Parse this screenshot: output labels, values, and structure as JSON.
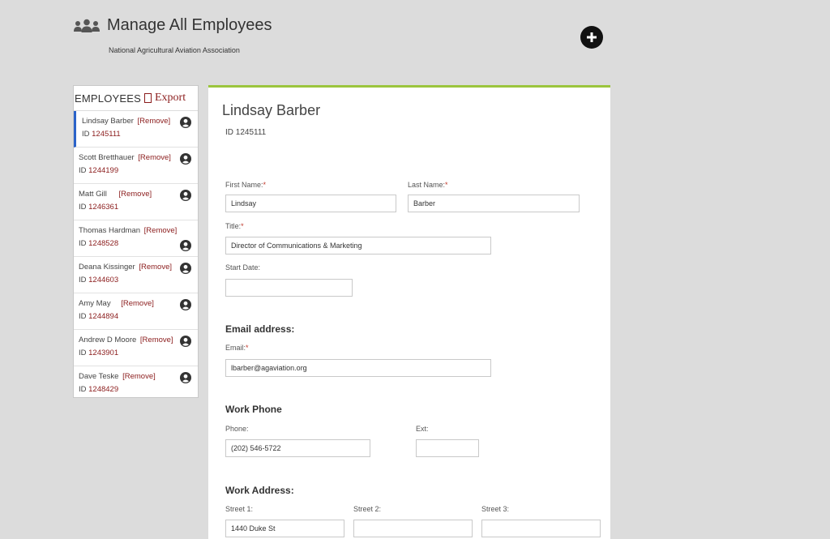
{
  "header": {
    "title": "Manage All Employees",
    "subtitle": "National Agricultural Aviation Association"
  },
  "employees_panel": {
    "title": "EMPLOYEES",
    "export_label": "Export",
    "remove_label": "[Remove]",
    "items": [
      {
        "name": "Lindsay Barber",
        "id_prefix": "ID",
        "id": "1245111",
        "active": true
      },
      {
        "name": "Scott Bretthauer",
        "id_prefix": "ID",
        "id": "1244199"
      },
      {
        "name": "Matt Gill",
        "id_prefix": "ID",
        "id": "1246361"
      },
      {
        "name": "Thomas Hardman",
        "id_prefix": "ID",
        "id": "1248528"
      },
      {
        "name": "Deana Kissinger",
        "id_prefix": "ID",
        "id": "1244603"
      },
      {
        "name": "Amy May",
        "id_prefix": "ID",
        "id": "1244894"
      },
      {
        "name": "Andrew D Moore",
        "id_prefix": "ID",
        "id": "1243901"
      },
      {
        "name": "Dave Teske",
        "id_prefix": "ID",
        "id": "1248429"
      }
    ]
  },
  "detail": {
    "name": "Lindsay Barber",
    "id_text": "ID 1245111",
    "first_name": {
      "label": "First Name:",
      "required": "*",
      "value": "Lindsay"
    },
    "last_name": {
      "label": "Last Name:",
      "required": "*",
      "value": "Barber"
    },
    "title": {
      "label": "Title:",
      "required": "*",
      "value": "Director of Communications & Marketing"
    },
    "start_date": {
      "label": "Start Date:",
      "value": ""
    },
    "email_section": "Email address:",
    "email": {
      "label": "Email:",
      "required": "*",
      "value": "lbarber@agaviation.org"
    },
    "phone_section": "Work Phone",
    "phone": {
      "label": "Phone:",
      "value": "(202) 546-5722"
    },
    "ext": {
      "label": "Ext:",
      "value": ""
    },
    "address_section": "Work Address:",
    "street1": {
      "label": "Street 1:",
      "value": "1440 Duke St"
    },
    "street2": {
      "label": "Street 2:",
      "value": ""
    },
    "street3": {
      "label": "Street 3:",
      "value": ""
    }
  },
  "icons": {
    "header_icon": "users-icon",
    "add_icon": "plus-circle-icon",
    "employee_icon": "user-circle-icon"
  },
  "colors": {
    "accent_green": "#9bc53d",
    "link_red": "#8b1c1c",
    "active_blue": "#2a62c9"
  }
}
